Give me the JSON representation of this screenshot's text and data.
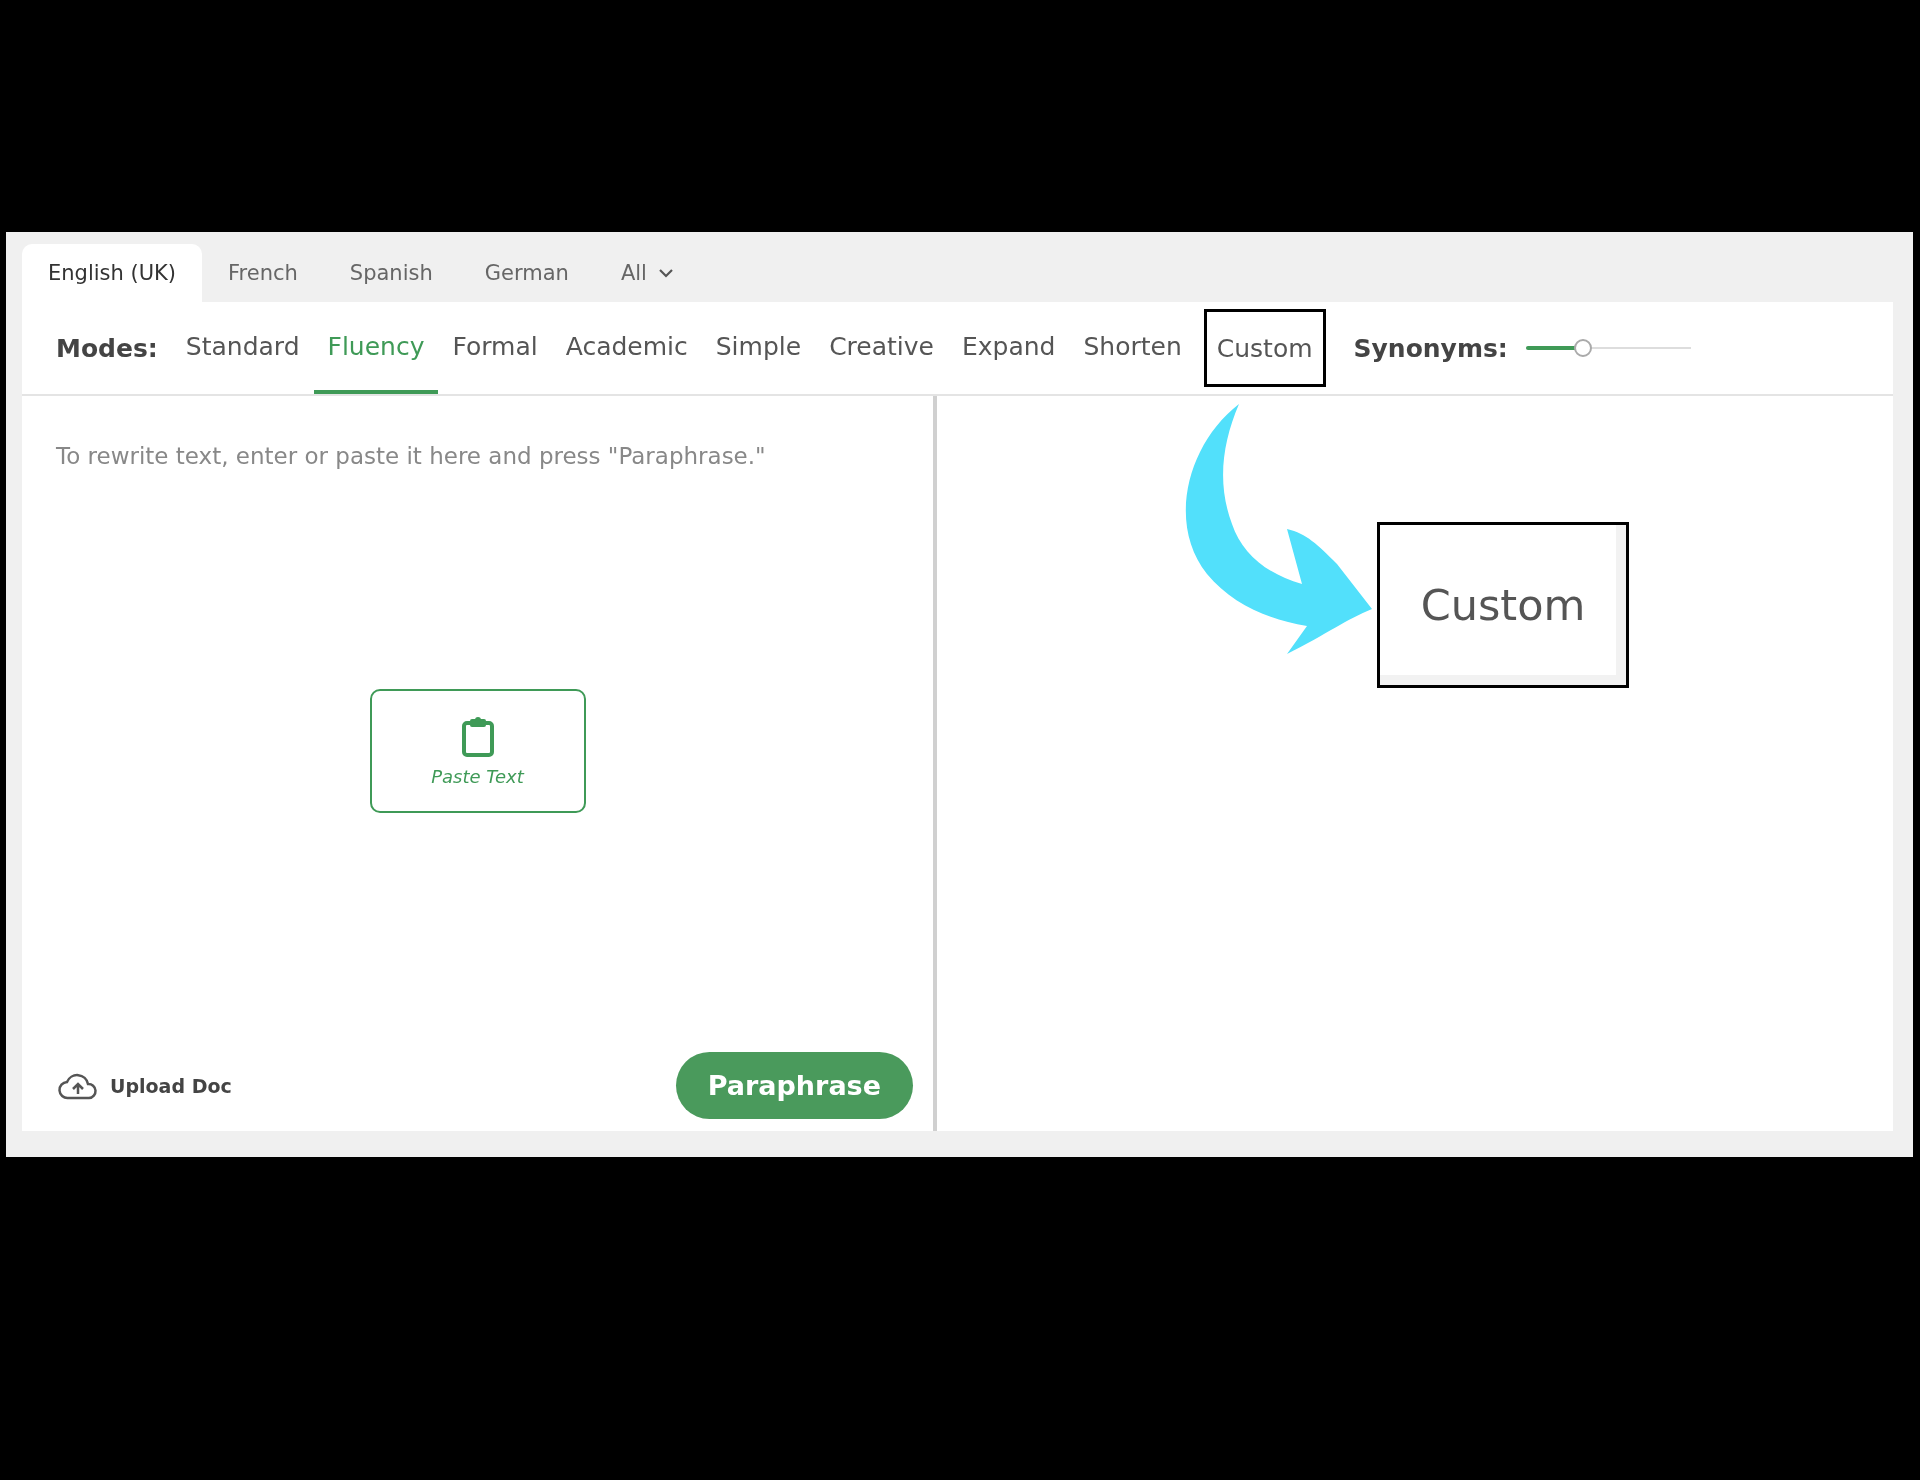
{
  "language_tabs": [
    {
      "label": "English (UK)",
      "selected": true,
      "kind": "tab"
    },
    {
      "label": "French",
      "selected": false,
      "kind": "tab"
    },
    {
      "label": "Spanish",
      "selected": false,
      "kind": "tab"
    },
    {
      "label": "German",
      "selected": false,
      "kind": "tab"
    },
    {
      "label": "All",
      "selected": false,
      "kind": "dropdown"
    }
  ],
  "modes": {
    "label": "Modes:",
    "items": [
      {
        "label": "Standard",
        "selected": false,
        "highlighted": false
      },
      {
        "label": "Fluency",
        "selected": true,
        "highlighted": false
      },
      {
        "label": "Formal",
        "selected": false,
        "highlighted": false
      },
      {
        "label": "Academic",
        "selected": false,
        "highlighted": false
      },
      {
        "label": "Simple",
        "selected": false,
        "highlighted": false
      },
      {
        "label": "Creative",
        "selected": false,
        "highlighted": false
      },
      {
        "label": "Expand",
        "selected": false,
        "highlighted": false
      },
      {
        "label": "Shorten",
        "selected": false,
        "highlighted": false
      },
      {
        "label": "Custom",
        "selected": false,
        "highlighted": true
      }
    ]
  },
  "synonyms": {
    "label": "Synonyms:",
    "level": 0.33
  },
  "input": {
    "placeholder": "To rewrite text, enter or paste it here and press \"Paraphrase.\""
  },
  "paste_button": "Paste Text",
  "upload_button": "Upload Doc",
  "paraphrase_button": "Paraphrase",
  "callout": {
    "label": "Custom"
  }
}
